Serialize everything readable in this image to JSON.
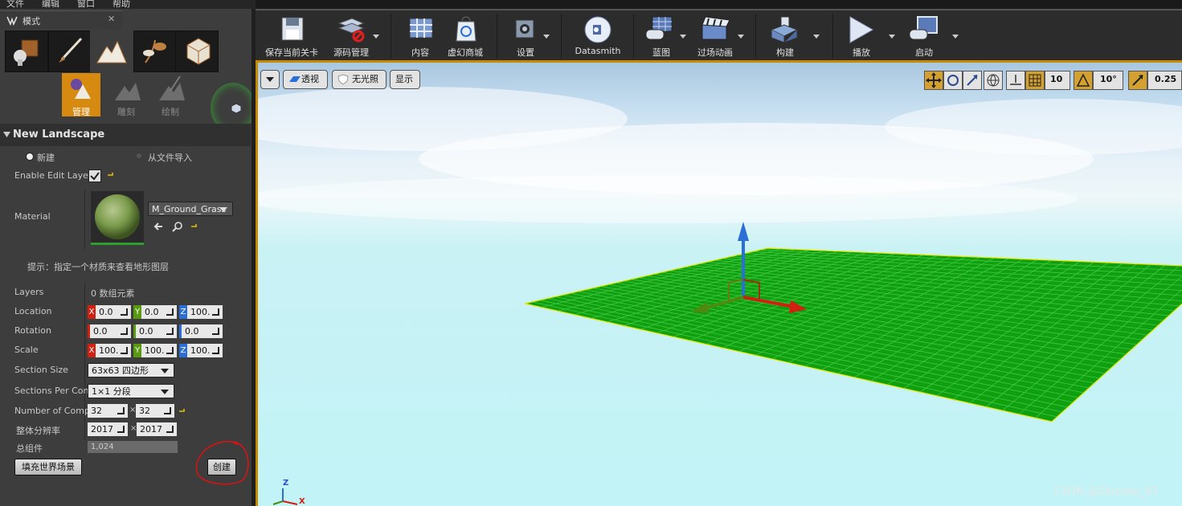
{
  "menubar": {
    "items": [
      "文件",
      "编辑",
      "窗口",
      "帮助"
    ]
  },
  "modes_panel": {
    "tab_title": "模式",
    "close_glyph": "✕",
    "subtools": [
      {
        "label": "管理",
        "selected": true
      },
      {
        "label": "雕刻",
        "selected": false
      },
      {
        "label": "绘制",
        "selected": false
      }
    ]
  },
  "landscape": {
    "section_title": "New Landscape",
    "source_options": [
      "新建",
      "从文件导入"
    ],
    "enable_edit_layer_label": "Enable Edit Layer",
    "material_label": "Material",
    "material_value": "M_Ground_Grass",
    "hint": "提示：指定一个材质来查看地形图层",
    "layers_label": "Layers",
    "layers_value": "0 数组元素",
    "location_label": "Location",
    "location": {
      "x": "0.0",
      "y": "0.0",
      "z": "100."
    },
    "rotation_label": "Rotation",
    "rotation": {
      "x": "0.0",
      "y": "0.0",
      "z": "0.0"
    },
    "scale_label": "Scale",
    "scale": {
      "x": "100.",
      "y": "100.",
      "z": "100."
    },
    "axis_letters": {
      "x": "X",
      "y": "Y",
      "z": "Z"
    },
    "section_size_label": "Section Size",
    "section_size_value": "63x63 四边形",
    "sections_per_comp_label": "Sections Per Con",
    "sections_per_comp_value": "1×1 分段",
    "num_components_label": "Number of Comp",
    "num_components": [
      "32",
      "32"
    ],
    "resolution_label": "整体分辨率",
    "resolution": [
      "2017",
      "2017"
    ],
    "times_glyph": "×",
    "total_components_label": "总组件",
    "total_components_value": "1,024",
    "fill_world_button": "填充世界场景",
    "create_button": "创建"
  },
  "toolbar": {
    "buttons": [
      {
        "label": "保存当前关卡",
        "icon": "save-icon"
      },
      {
        "label": "源码管理",
        "icon": "source-control-icon"
      },
      {
        "label": "内容",
        "icon": "content-icon"
      },
      {
        "label": "虚幻商城",
        "icon": "marketplace-icon"
      },
      {
        "label": "设置",
        "icon": "settings-icon"
      },
      {
        "label": "Datasmith",
        "icon": "datasmith-icon"
      },
      {
        "label": "蓝图",
        "icon": "blueprint-icon"
      },
      {
        "label": "过场动画",
        "icon": "cinematics-icon"
      },
      {
        "label": "构建",
        "icon": "build-icon"
      },
      {
        "label": "播放",
        "icon": "play-icon"
      },
      {
        "label": "启动",
        "icon": "launch-icon"
      }
    ]
  },
  "viewport": {
    "perspective_label": "透视",
    "lighting_label": "无光照",
    "show_label": "显示",
    "grid_snap_value": "10",
    "rotation_snap_value": "10°",
    "scale_snap_value": "0.25",
    "axis_labels": {
      "z": "Z",
      "x": "X"
    }
  },
  "watermark": "CSDN @Zhichao_97",
  "colors": {
    "accent": "#c78a00",
    "landscape_green": "#0fa010",
    "axis_x": "#d02010",
    "axis_y": "#5a9a10",
    "axis_z": "#2a6ed8"
  }
}
